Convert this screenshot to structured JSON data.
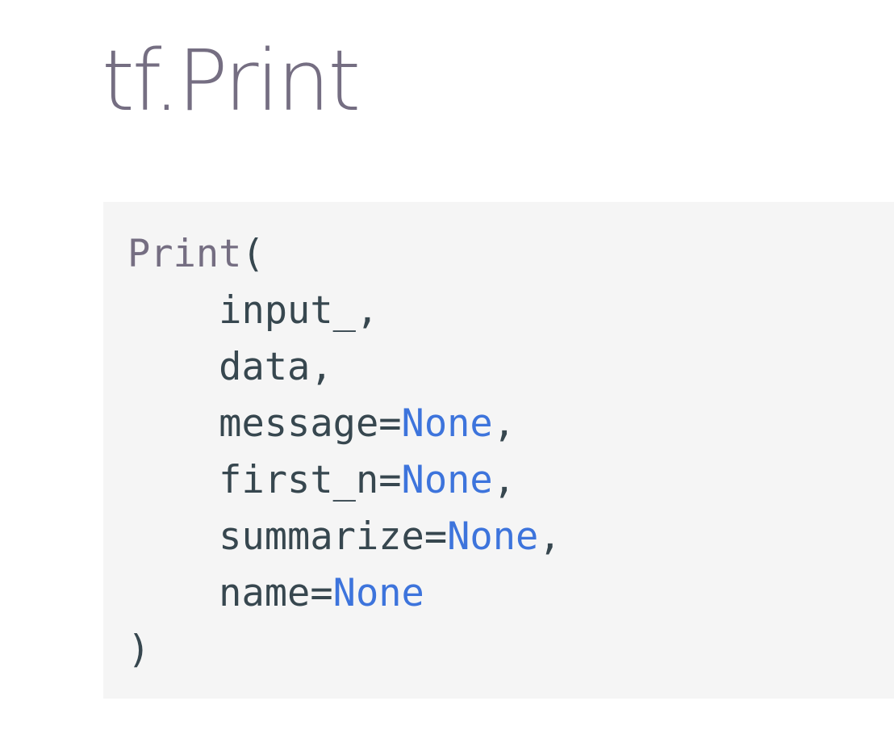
{
  "page": {
    "title": "tf.Print"
  },
  "code": {
    "function_name": "Print",
    "open_paren": "(",
    "close_paren": ")",
    "params": [
      {
        "name": "input_",
        "eq": "",
        "default": "",
        "sep": ","
      },
      {
        "name": "data",
        "eq": "",
        "default": "",
        "sep": ","
      },
      {
        "name": "message",
        "eq": "=",
        "default": "None",
        "sep": ","
      },
      {
        "name": "first_n",
        "eq": "=",
        "default": "None",
        "sep": ","
      },
      {
        "name": "summarize",
        "eq": "=",
        "default": "None",
        "sep": ","
      },
      {
        "name": "name",
        "eq": "=",
        "default": "None",
        "sep": ""
      }
    ]
  },
  "colors": {
    "title": "#756e82",
    "code_text": "#37474f",
    "keyword_none": "#3d74dc",
    "code_background": "#f5f5f5"
  }
}
